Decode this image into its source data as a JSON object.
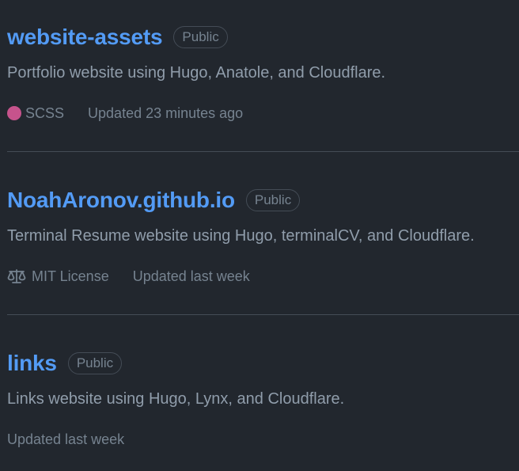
{
  "repos": [
    {
      "name": "website-assets",
      "visibility": "Public",
      "description": "Portfolio website using Hugo, Anatole, and Cloudflare.",
      "language": "SCSS",
      "language_color": "#c6538c",
      "updated": "Updated 23 minutes ago"
    },
    {
      "name": "NoahAronov.github.io",
      "visibility": "Public",
      "description": "Terminal Resume website using Hugo, terminalCV, and Cloudflare.",
      "license": "MIT License",
      "license_icon": "law-icon",
      "updated": "Updated last week"
    },
    {
      "name": "links",
      "visibility": "Public",
      "description": "Links website using Hugo, Lynx, and Cloudflare.",
      "updated": "Updated last week"
    }
  ],
  "colors": {
    "background": "#22272e",
    "link": "#539bf5",
    "muted": "#768390",
    "border": "#444c56"
  }
}
